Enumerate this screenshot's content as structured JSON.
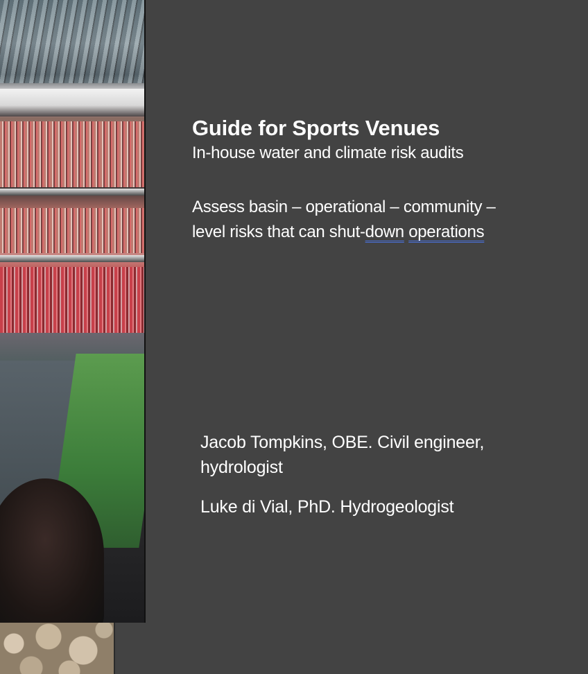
{
  "cover": {
    "title": "Guide for Sports Venues",
    "subtitle": "In-house water and climate risk audits",
    "assess_prefix": "Assess basin – operational – community – level risks that can shut-",
    "assess_underlined_1": "down",
    "assess_underlined_2": "operations"
  },
  "authors": [
    {
      "text": "Jacob Tompkins, OBE.  Civil engineer, hydrologist"
    },
    {
      "text": "Luke di Vial, PhD.  Hydrogeologist"
    }
  ],
  "colors": {
    "background": "#434343",
    "text": "#ffffff",
    "spellcheck_underline": "#4a6fd4"
  }
}
